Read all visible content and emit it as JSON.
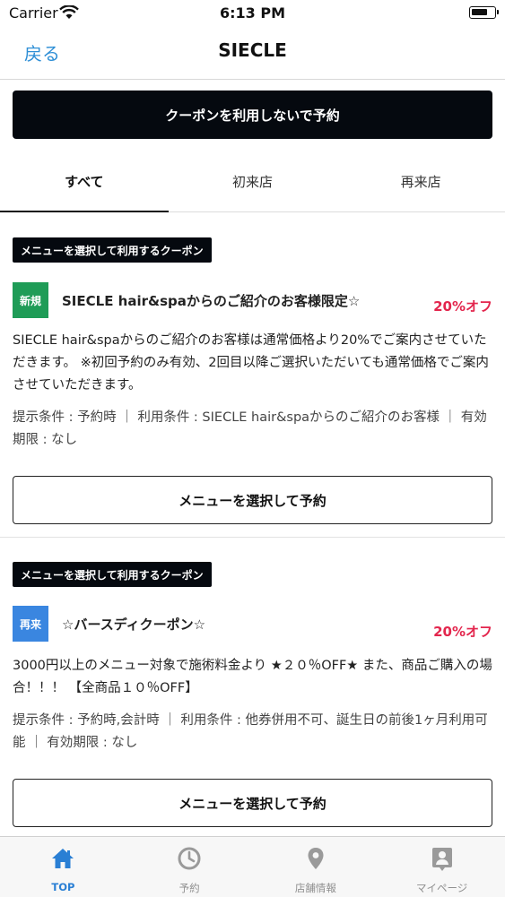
{
  "status_bar": {
    "carrier": "Carrier",
    "time": "6:13 PM"
  },
  "nav": {
    "back_label": "戻る",
    "title": "SIECLE"
  },
  "reserve_without_coupon": "クーポンを利用しないで予約",
  "tabs": [
    {
      "label": "すべて",
      "active": true
    },
    {
      "label": "初来店",
      "active": false
    },
    {
      "label": "再来店",
      "active": false
    }
  ],
  "coupons": [
    {
      "tag": "メニューを選択して利用するクーポン",
      "badge": "新規",
      "badge_color": "#1f9c57",
      "title": "SIECLE hair&spaからのご紹介のお客様限定☆",
      "discount": "20%オフ",
      "description": "SIECLE hair&spaからのご紹介のお客様は通常価格より20%でご案内させていただきます。 ※初回予約のみ有効、2回目以降ご選択いただいても通常価格でご案内させていただきます。",
      "conditions": "提示条件 : 予約時 ｜ 利用条件 : SIECLE hair&spaからのご紹介のお客様 ｜ 有効期限 : なし",
      "button_label": "メニューを選択して予約"
    },
    {
      "tag": "メニューを選択して利用するクーポン",
      "badge": "再来",
      "badge_color": "#3a86e0",
      "title": "☆バースディクーポン☆",
      "discount": "20%オフ",
      "description": "3000円以上のメニュー対象で施術料金より ★２０％OFF★ また、商品ご購入の場合！！！ 【全商品１０％OFF】",
      "conditions": "提示条件 : 予約時,会計時 ｜ 利用条件 : 他券併用不可、誕生日の前後1ヶ月利用可能 ｜ 有効期限 : なし",
      "button_label": "メニューを選択して予約"
    }
  ],
  "tab_bar": [
    {
      "label": "TOP",
      "icon": "home-icon",
      "active": true
    },
    {
      "label": "予約",
      "icon": "clock-icon",
      "active": false
    },
    {
      "label": "店舗情報",
      "icon": "location-pin-icon",
      "active": false
    },
    {
      "label": "マイページ",
      "icon": "profile-card-icon",
      "active": false
    }
  ],
  "colors": {
    "accent_blue": "#2a7fd4",
    "discount_red": "#e3264d",
    "button_dark": "#05090f",
    "new_badge_green": "#1f9c57",
    "repeat_badge_blue": "#3a86e0"
  }
}
